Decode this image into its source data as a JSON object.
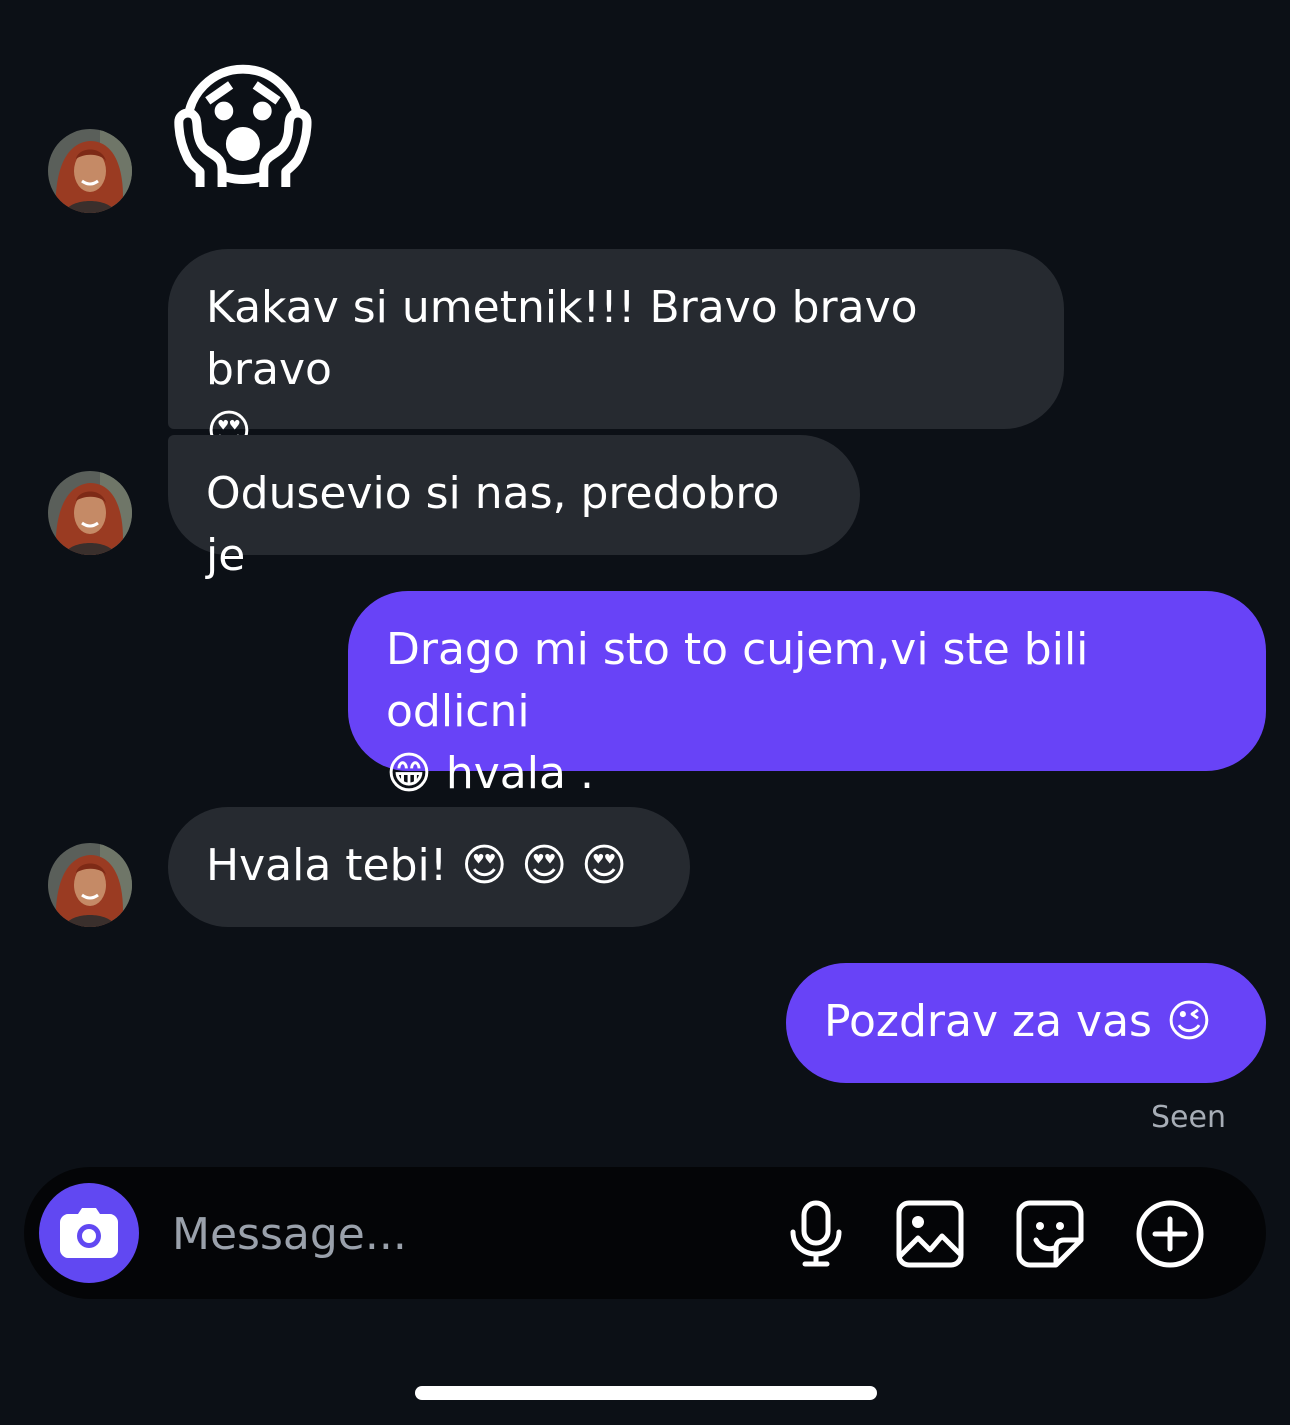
{
  "conversation": {
    "big_emoji": "😱",
    "messages": [
      {
        "direction": "incoming",
        "text": "Kakav si umetnik!!! Bravo bravo bravo",
        "emoji": "😍"
      },
      {
        "direction": "incoming",
        "text": "Odusevio si nas, predobro je"
      },
      {
        "direction": "outgoing",
        "text": "Drago mi sto to cujem,vi ste bili odlicni",
        "emoji": "😁",
        "text_after": "hvala ."
      },
      {
        "direction": "incoming",
        "text": "Hvala tebi!",
        "emoji": "😍 😍 😍"
      },
      {
        "direction": "outgoing",
        "text": "Pozdrav za vas",
        "emoji": "😉"
      }
    ],
    "status": "Seen"
  },
  "composer": {
    "placeholder": "Message...",
    "buttons": [
      "camera-icon",
      "microphone-icon",
      "gallery-icon",
      "sticker-icon",
      "plus-icon"
    ]
  },
  "colors": {
    "background": "#0c1016",
    "incoming_bubble": "#262a30",
    "outgoing_bubble": "#6843f7",
    "camera_button": "#6148f2"
  }
}
